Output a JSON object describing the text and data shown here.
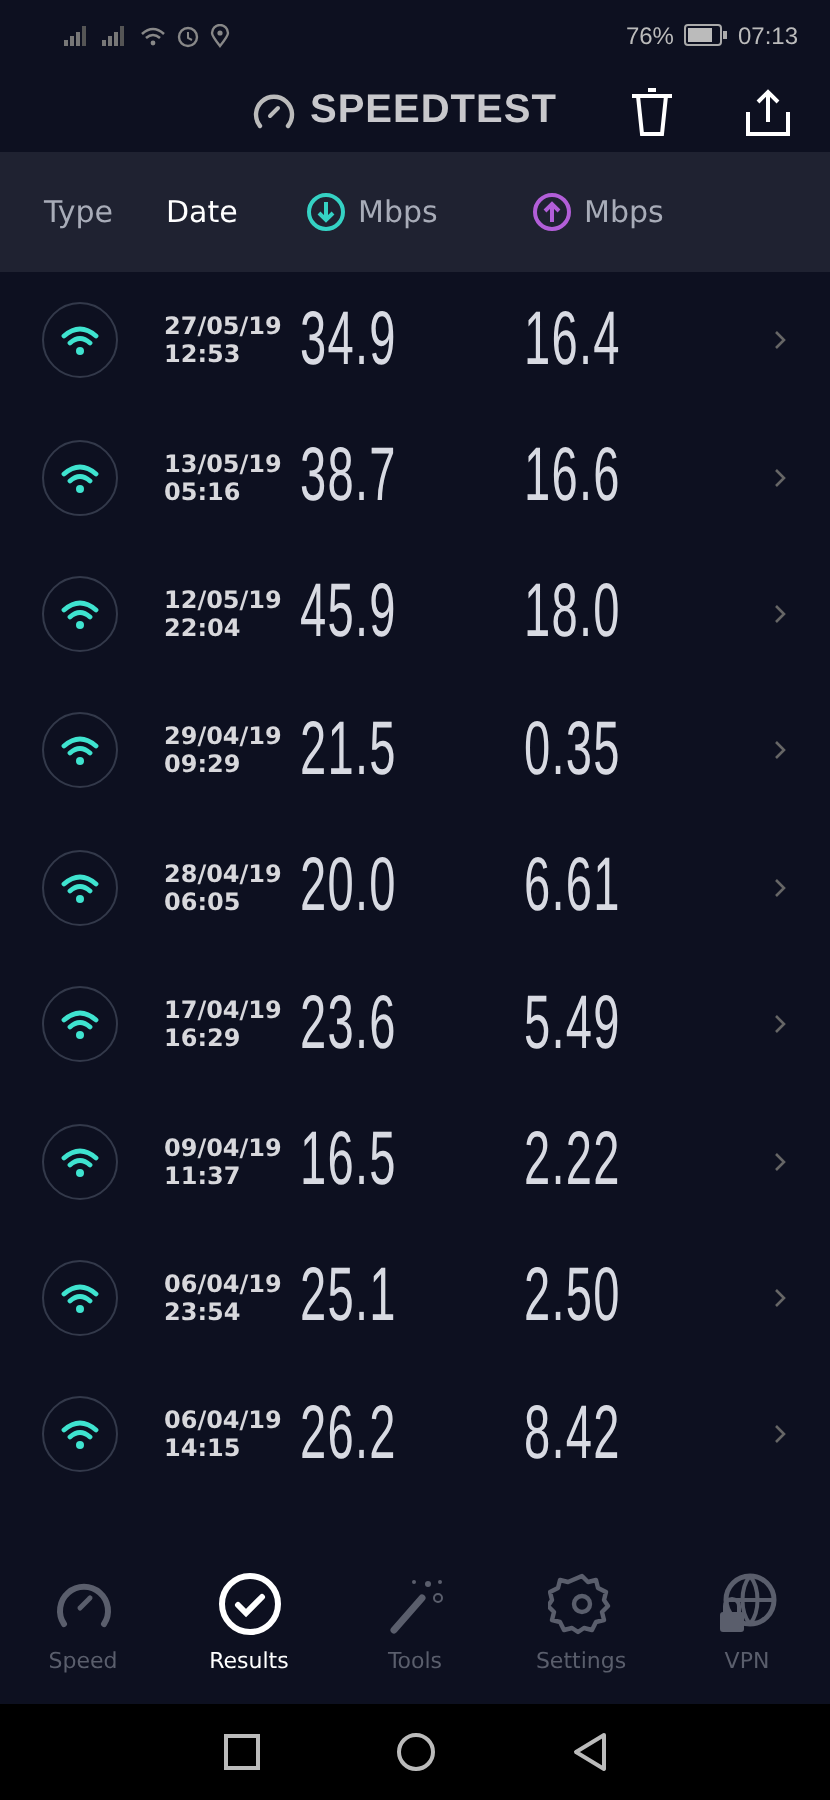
{
  "status_bar": {
    "battery": "76%",
    "time": "07:13"
  },
  "header": {
    "title": "SPEEDTEST"
  },
  "columns": [
    {
      "label": "Type",
      "kind": "text",
      "selected": false
    },
    {
      "label": "Date",
      "kind": "text",
      "selected": true
    },
    {
      "label": "Mbps",
      "kind": "download",
      "selected": false
    },
    {
      "label": "Mbps",
      "kind": "upload",
      "selected": false
    }
  ],
  "rows": [
    {
      "kind": "wifi",
      "date": "27/05/19",
      "time": "12:53",
      "download": "34.9",
      "upload": "16.4"
    },
    {
      "kind": "wifi",
      "date": "13/05/19",
      "time": "05:16",
      "download": "38.7",
      "upload": "16.6"
    },
    {
      "kind": "wifi",
      "date": "12/05/19",
      "time": "22:04",
      "download": "45.9",
      "upload": "18.0"
    },
    {
      "kind": "wifi",
      "date": "29/04/19",
      "time": "09:29",
      "download": "21.5",
      "upload": "0.35"
    },
    {
      "kind": "wifi",
      "date": "28/04/19",
      "time": "06:05",
      "download": "20.0",
      "upload": "6.61"
    },
    {
      "kind": "wifi",
      "date": "17/04/19",
      "time": "16:29",
      "download": "23.6",
      "upload": "5.49"
    },
    {
      "kind": "wifi",
      "date": "09/04/19",
      "time": "11:37",
      "download": "16.5",
      "upload": "2.22"
    },
    {
      "kind": "wifi",
      "date": "06/04/19",
      "time": "23:54",
      "download": "25.1",
      "upload": "2.50"
    },
    {
      "kind": "wifi",
      "date": "06/04/19",
      "time": "14:15",
      "download": "26.2",
      "upload": "8.42"
    }
  ],
  "nav": [
    {
      "label": "Speed",
      "kind": "speed",
      "selected": false
    },
    {
      "label": "Results",
      "kind": "results",
      "selected": true
    },
    {
      "label": "Tools",
      "kind": "tools",
      "selected": false
    },
    {
      "label": "Settings",
      "kind": "settings",
      "selected": false
    },
    {
      "label": "VPN",
      "kind": "vpn",
      "selected": false
    }
  ]
}
